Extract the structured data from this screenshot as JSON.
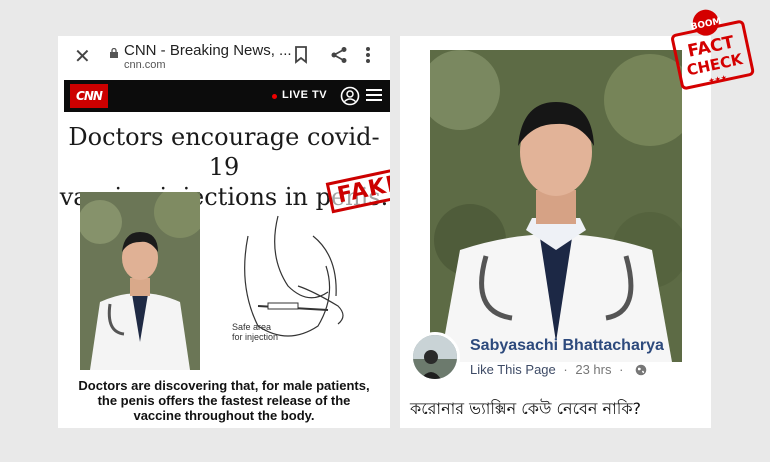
{
  "browser": {
    "close_glyph": "✕",
    "tab_title": "CNN - Breaking News, ...",
    "domain": "cnn.com"
  },
  "cnn_header": {
    "logo_text": "CNN",
    "live_label": "LIVE TV"
  },
  "article": {
    "headline_line1": "Doctors encourage covid-19",
    "headline_line2": "vaccine injections in penis.",
    "illustration_label_line1": "Safe area",
    "illustration_label_line2": "for injection",
    "fake_stamp": "FAKE",
    "caption_line1": "Doctors are discovering that, for male patients,",
    "caption_line2": "the penis offers the fastest release of the",
    "caption_line3": "vaccine throughout the body."
  },
  "facebook_post": {
    "author": "Sabyasachi Bhattacharya",
    "like_page": "Like This Page",
    "separator": "·",
    "time": "23 hrs",
    "text": "করোনার ভ্যাক্সিন কেউ নেবেন নাকি?"
  },
  "fact_check_stamp": {
    "brand": "BOOM",
    "word1": "FACT",
    "word2": "CHECK",
    "stars": "★★★",
    "color": "#d40000"
  },
  "icons": [
    "close-icon",
    "lock-icon",
    "bookmark-icon",
    "share-icon",
    "more-vert-icon",
    "user-icon",
    "menu-icon",
    "globe-icon"
  ]
}
